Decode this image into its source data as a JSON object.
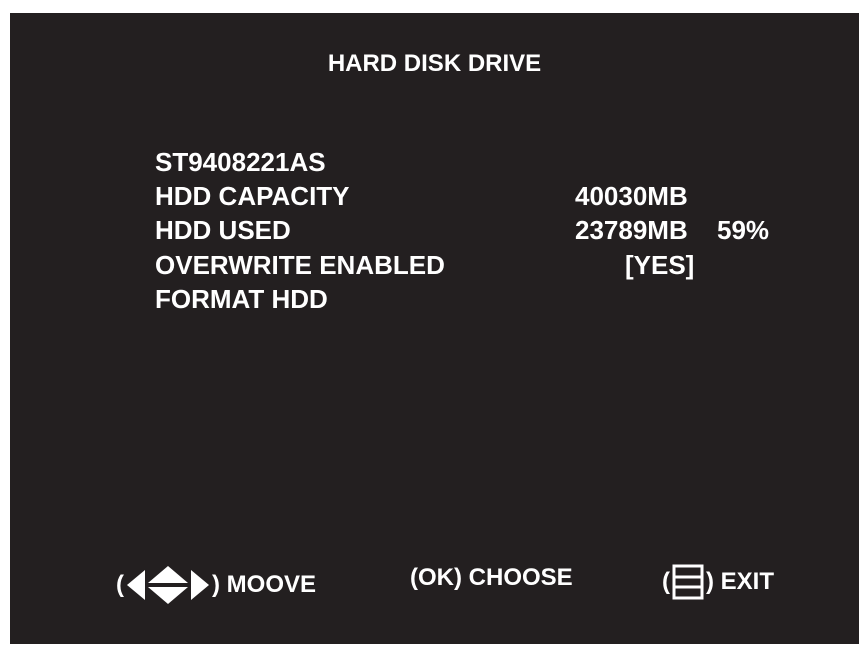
{
  "title": "HARD DISK DRIVE",
  "info": {
    "model": "ST9408221AS",
    "capacity_label": "HDD CAPACITY",
    "capacity_value": "40030MB",
    "used_label": "HDD USED",
    "used_value": "23789MB",
    "used_percent": "59%",
    "overwrite_label": "OVERWRITE ENABLED",
    "overwrite_value": "[YES]",
    "format_label": "FORMAT HDD"
  },
  "footer": {
    "move_open": "(",
    "move_label": ") MOOVE",
    "choose_label": "(OK) CHOOSE",
    "exit_open": "(",
    "exit_label": ") EXIT",
    "move_icon": "arrows-icon",
    "exit_icon": "menu-icon"
  },
  "colors": {
    "background": "#231f20",
    "text": "#ffffff"
  }
}
